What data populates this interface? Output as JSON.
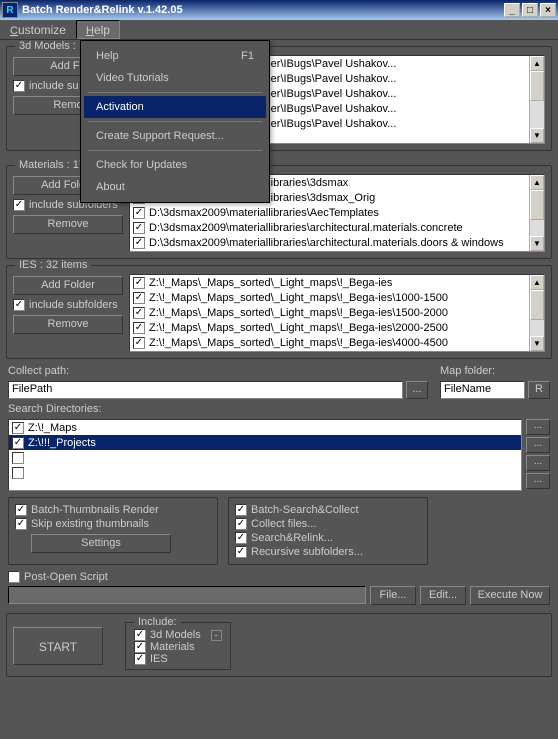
{
  "window": {
    "title": "Batch Render&Relink v.1.42.05"
  },
  "menubar": {
    "customize": "Customize",
    "help": "Help"
  },
  "help_menu": {
    "help": "Help",
    "help_shortcut": "F1",
    "video": "Video Tutorials",
    "activation": "Activation",
    "support": "Create Support Request...",
    "updates": "Check for Updates",
    "about": "About"
  },
  "groups": {
    "models_title": "3d Models :",
    "materials_title": "Materials : 17",
    "ies_title": "IES : 32 items",
    "add_folder": "Add Folder",
    "include_sub": "include subfolders",
    "remove": "Remove"
  },
  "models_items": [
    "ackScripts\\ProjectManager\\IBugs\\Pavel Ushakov...",
    "ackScripts\\ProjectManager\\IBugs\\Pavel Ushakov...",
    "ackScripts\\ProjectManager\\IBugs\\Pavel Ushakov...",
    "ackScripts\\ProjectManager\\IBugs\\Pavel Ushakov...",
    "ackScripts\\ProjectManager\\IBugs\\Pavel Ushakov..."
  ],
  "materials_items": [
    "D:\\3dsmax2009\\materiallibraries\\3dsmax",
    "D:\\3dsmax2009\\materiallibraries\\3dsmax_Orig",
    "D:\\3dsmax2009\\materiallibraries\\AecTemplates",
    "D:\\3dsmax2009\\materiallibraries\\architectural.materials.concrete",
    "D:\\3dsmax2009\\materiallibraries\\architectural.materials.doors & windows"
  ],
  "ies_items": [
    "Z:\\!_Maps\\_Maps_sorted\\_Light_maps\\!_Bega-ies",
    "Z:\\!_Maps\\_Maps_sorted\\_Light_maps\\!_Bega-ies\\1000-1500",
    "Z:\\!_Maps\\_Maps_sorted\\_Light_maps\\!_Bega-ies\\1500-2000",
    "Z:\\!_Maps\\_Maps_sorted\\_Light_maps\\!_Bega-ies\\2000-2500",
    "Z:\\!_Maps\\_Maps_sorted\\_Light_maps\\!_Bega-ies\\4000-4500"
  ],
  "collect": {
    "path_label": "Collect path:",
    "path_value": "FilePath",
    "browse": "...",
    "map_label": "Map folder:",
    "map_value": "FileName",
    "r": "R"
  },
  "search": {
    "label": "Search Directories:",
    "items": [
      "Z:\\!_Maps",
      "Z:\\!!!_Projects",
      "",
      ""
    ]
  },
  "batch_thumb": {
    "title": "Batch-Thumbnails Render",
    "skip": "Skip existing thumbnails",
    "settings": "Settings"
  },
  "batch_search": {
    "title": "Batch-Search&Collect",
    "collect": "Collect files...",
    "relink": "Search&Relink...",
    "recursive": "Recursive subfolders..."
  },
  "postopen": {
    "label": "Post-Open Script",
    "file": "File...",
    "edit": "Edit...",
    "execute": "Execute Now"
  },
  "include": {
    "title": "Include:",
    "models": "3d Models",
    "materials": "Materials",
    "ies": "IES"
  },
  "start": "START"
}
